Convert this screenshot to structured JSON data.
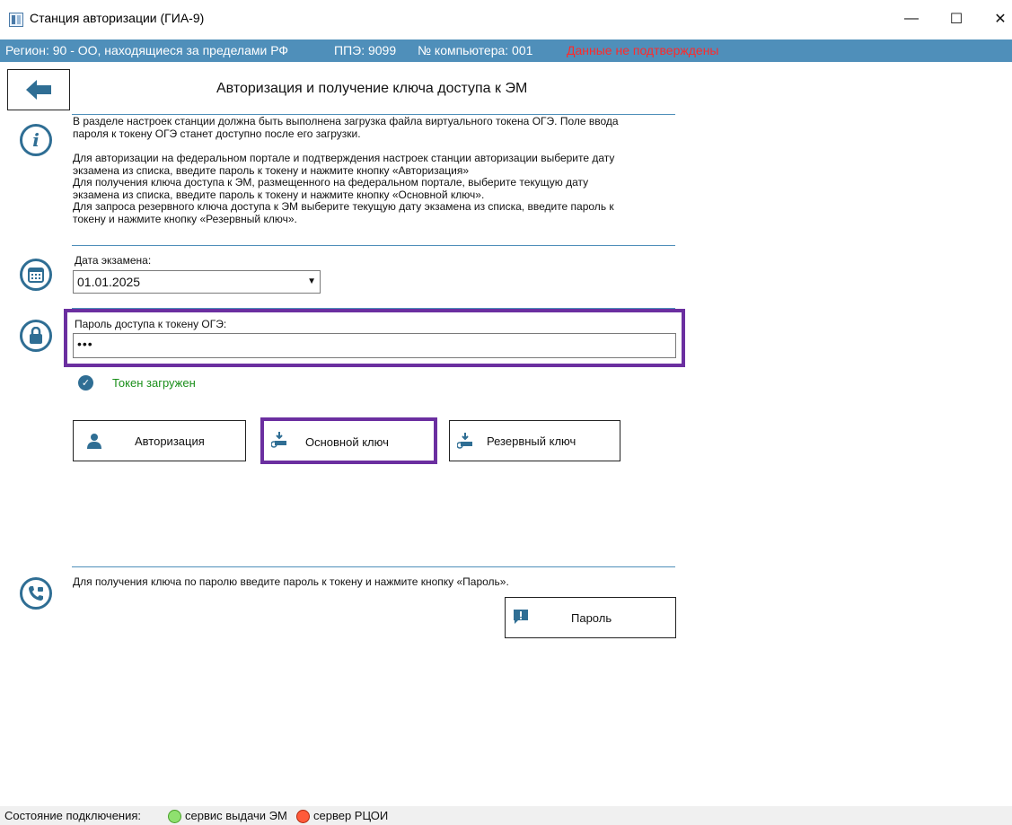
{
  "window": {
    "title": "Станция авторизации (ГИА-9)",
    "controls": {
      "minimize": "—",
      "maximize": "☐",
      "close": "✕"
    }
  },
  "info_bar": {
    "region": "Регион: 90 - ОО, находящиеся за пределами РФ",
    "ppe": "ППЭ: 9099",
    "computer": "№ компьютера: 001",
    "status": "Данные не подтверждены",
    "status_color": "#ff2a2a",
    "bar_color": "#4f8fba"
  },
  "header": {
    "back_icon": "arrow-left-icon",
    "title": "Авторизация и получение ключа доступа к ЭМ"
  },
  "info_section": {
    "icon": "info-icon",
    "lines": [
      "В разделе настроек станции должна быть выполнена загрузка файла виртуального токена ОГЭ. Поле ввода",
      "пароля к токену ОГЭ станет доступно после его загрузки.",
      "",
      "Для авторизации на федеральном портале и подтверждения настроек станции авторизации выберите дату",
      "экзамена из списка, введите пароль к токену и нажмите кнопку «Авторизация»",
      "Для получения ключа доступа к ЭМ, размещенного на федеральном портале, выберите текущую дату",
      "экзамена из списка, введите пароль к токену и нажмите кнопку «Основной ключ».",
      "Для запроса резервного ключа доступа к ЭМ выберите текущую дату экзамена из списка, введите пароль к",
      "токену и нажмите кнопку «Резервный ключ»."
    ]
  },
  "date_section": {
    "icon": "calendar-icon",
    "label": "Дата экзамена:",
    "value": "01.01.2025"
  },
  "password_section": {
    "icon": "lock-icon",
    "label": "Пароль доступа к токену ОГЭ:",
    "value": "•••",
    "token_status": "Токен загружен",
    "token_status_color": "#1a8f1a"
  },
  "actions": {
    "auth": {
      "label": "Авторизация",
      "icon": "user-icon"
    },
    "main_key": {
      "label": "Основной ключ",
      "icon": "key-download-icon"
    },
    "reserve_key": {
      "label": "Резервный ключ",
      "icon": "key-download-icon"
    }
  },
  "phone_section": {
    "icon": "phone-icon",
    "text": "Для получения ключа по паролю введите пароль к токену и нажмите кнопку «Пароль».",
    "button": {
      "label": "Пароль",
      "icon": "message-alert-icon"
    }
  },
  "status_bar": {
    "label": "Состояние подключения:",
    "items": [
      {
        "text": "сервис выдачи ЭМ",
        "color": "#66cc44"
      },
      {
        "text": "сервер РЦОИ",
        "color": "#e8442a"
      }
    ]
  },
  "accent_color": "#6b2fa0",
  "icon_color": "#2f6e94"
}
